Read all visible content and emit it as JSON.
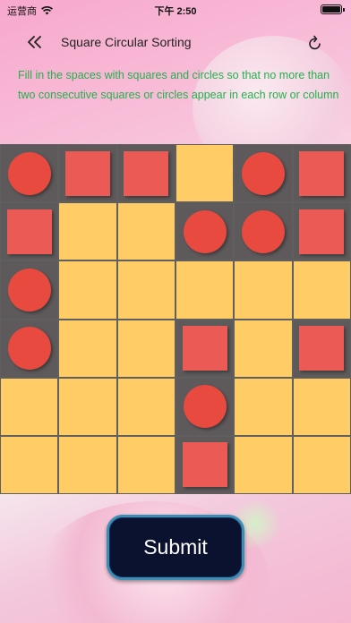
{
  "status_bar": {
    "carrier": "运营商",
    "time": "下午 2:50"
  },
  "nav": {
    "title": "Square Circular Sorting"
  },
  "instructions": "Fill in the spaces with squares and circles so that no more than two consecutive squares or circles appear in each row or column",
  "board": {
    "rows": [
      [
        "circle",
        "square",
        "square",
        "",
        "circle",
        "square"
      ],
      [
        "square",
        "",
        "",
        "circle",
        "circle",
        "square"
      ],
      [
        "circle",
        "",
        "",
        "",
        "",
        ""
      ],
      [
        "circle",
        "",
        "",
        "square",
        "",
        "square"
      ],
      [
        "",
        "",
        "",
        "circle",
        "",
        ""
      ],
      [
        "",
        "",
        "",
        "square",
        "",
        ""
      ]
    ]
  },
  "submit_label": "Submit",
  "colors": {
    "empty_cell": "#ffcc66",
    "fixed_cell": "#5e5a5b",
    "piece": "#e84a3f",
    "instruction_text": "#22b14c",
    "button_bg": "#0b1230",
    "button_border": "#3a8fb7"
  },
  "icons": {
    "back": "double-chevron-left-icon",
    "refresh": "refresh-icon",
    "wifi": "wifi-icon",
    "battery": "battery-icon"
  }
}
